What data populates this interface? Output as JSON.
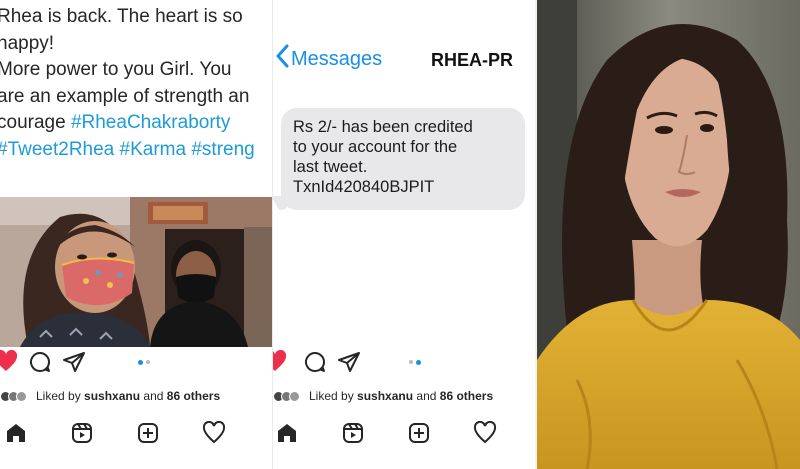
{
  "left_post": {
    "caption_lines": [
      "Rhea is back. The heart is so",
      "happy!",
      "More power to you Girl. You",
      "are an example of strength an",
      "courage "
    ],
    "hashtags": [
      "#RheaChakraborty",
      "#Tweet2Rhea",
      "#Karma",
      "#streng"
    ],
    "liked_prefix": "Liked by",
    "liked_user": "sushxanu",
    "liked_and": "and",
    "liked_others": "86 others"
  },
  "mid_post": {
    "back_label": "Messages",
    "sender": "RHEA-PR",
    "message_lines": [
      "Rs 2/- has been credited",
      "to your account for the",
      "last tweet.",
      "TxnId420840BJPIT"
    ],
    "liked_prefix": "Liked by",
    "liked_user": "sushxanu",
    "liked_and": "and",
    "liked_others": "86 others"
  },
  "colors": {
    "hashtag": "#1d9bd8",
    "link_blue": "#1a8fe3",
    "like_red": "#ed2f4b",
    "bubble": "#e8e8ea",
    "kurta_yellow": "#d8a92a"
  },
  "icons": [
    "heart-icon",
    "comment-icon",
    "share-icon",
    "home-icon",
    "reels-icon",
    "create-icon",
    "activity-icon"
  ]
}
